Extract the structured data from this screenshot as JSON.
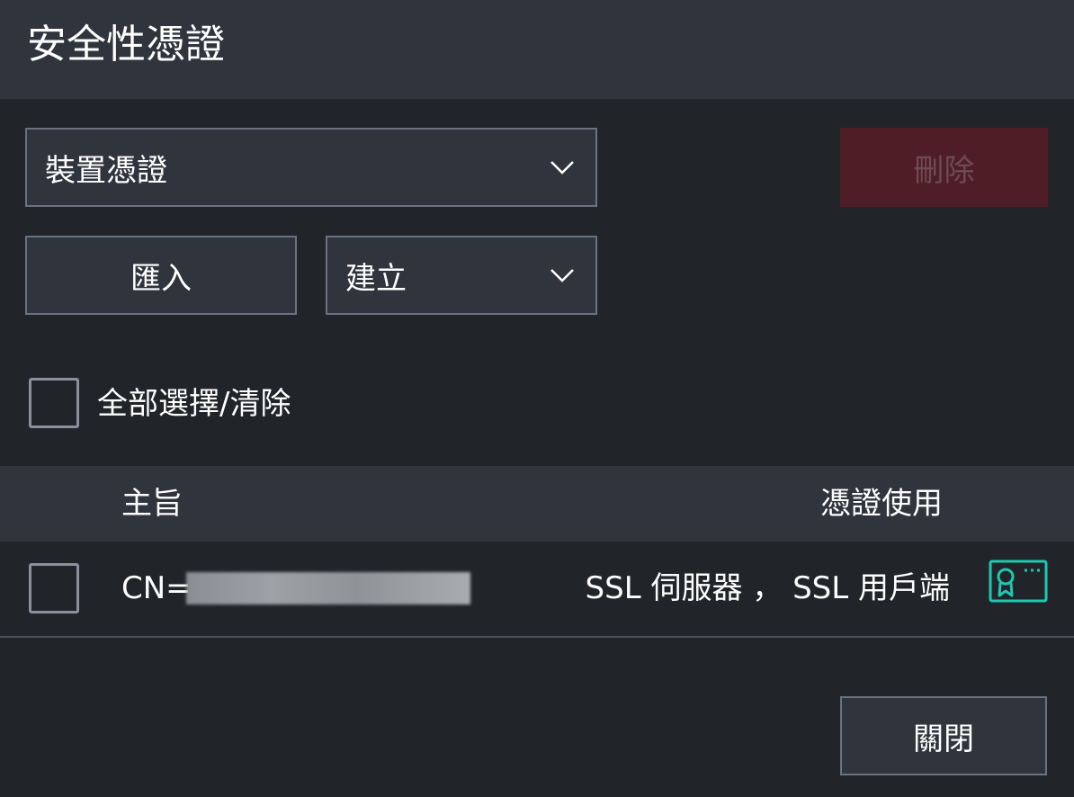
{
  "dialog": {
    "title": "安全性憑證"
  },
  "controls": {
    "cert_type_select": "裝置憑證",
    "delete_label": "刪除",
    "import_label": "匯入",
    "create_select": "建立",
    "select_all_label": "全部選擇/清除"
  },
  "table": {
    "columns": [
      "主旨",
      "憑證使用"
    ],
    "rows": [
      {
        "subject": "CN=",
        "usage": "SSL 伺服器 ， SSL 用戶端",
        "icon": "certificate-icon"
      }
    ]
  },
  "footer": {
    "close_label": "關閉"
  },
  "colors": {
    "accent": "#1fc9b0",
    "delete_bg": "#4f1d25",
    "header_bg": "#30343c",
    "body_bg": "#212429"
  }
}
